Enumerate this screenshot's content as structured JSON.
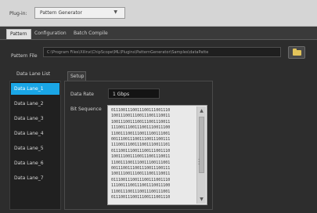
{
  "plugin": {
    "label": "Plug-in:",
    "selected": "Pattern Generator",
    "dropdown_icon": "chevron-down-icon"
  },
  "tabs": [
    {
      "label": "Pattern",
      "active": true
    },
    {
      "label": "Configuration",
      "active": false
    },
    {
      "label": "Batch Compile",
      "active": false
    }
  ],
  "pattern_file": {
    "label": "Pattern File",
    "value": "C:\\Program Files\\Xilinx\\ChipScope\\ML\\Plugins\\PatternGenerator\\Samples\\dataPatte",
    "browse_icon": "folder-icon"
  },
  "data_lane_list": {
    "label": "Data Lane List",
    "items": [
      "Data Lane_1",
      "Data Lane_2",
      "Data Lane_3",
      "Data Lane_4",
      "Data Lane_5",
      "Data Lane_6",
      "Data Lane_7"
    ],
    "selected_index": 0
  },
  "setup": {
    "tab_label": "Setup",
    "data_rate_label": "Data Rate",
    "data_rate_value": "1 Gbps",
    "bit_sequence_label": "Bit Sequence",
    "bit_sequence_lines": [
      "0111001110011100111001110",
      "1001110011100111001110011",
      "1001110011100111001110011",
      "1110011100111001110011100",
      "1100111001110011100111001",
      "0011100111001110011100111",
      "1110011100111001110011101",
      "0111001110011100111001110",
      "1001110011100111001110011",
      "1100111001110011100111001",
      "0011100111001110011100111",
      "1001110011100111001110011",
      "0111001110011100111001110",
      "1110011100111001110011100",
      "1100111001110011100111001",
      "0111001110011100111001110"
    ]
  }
}
